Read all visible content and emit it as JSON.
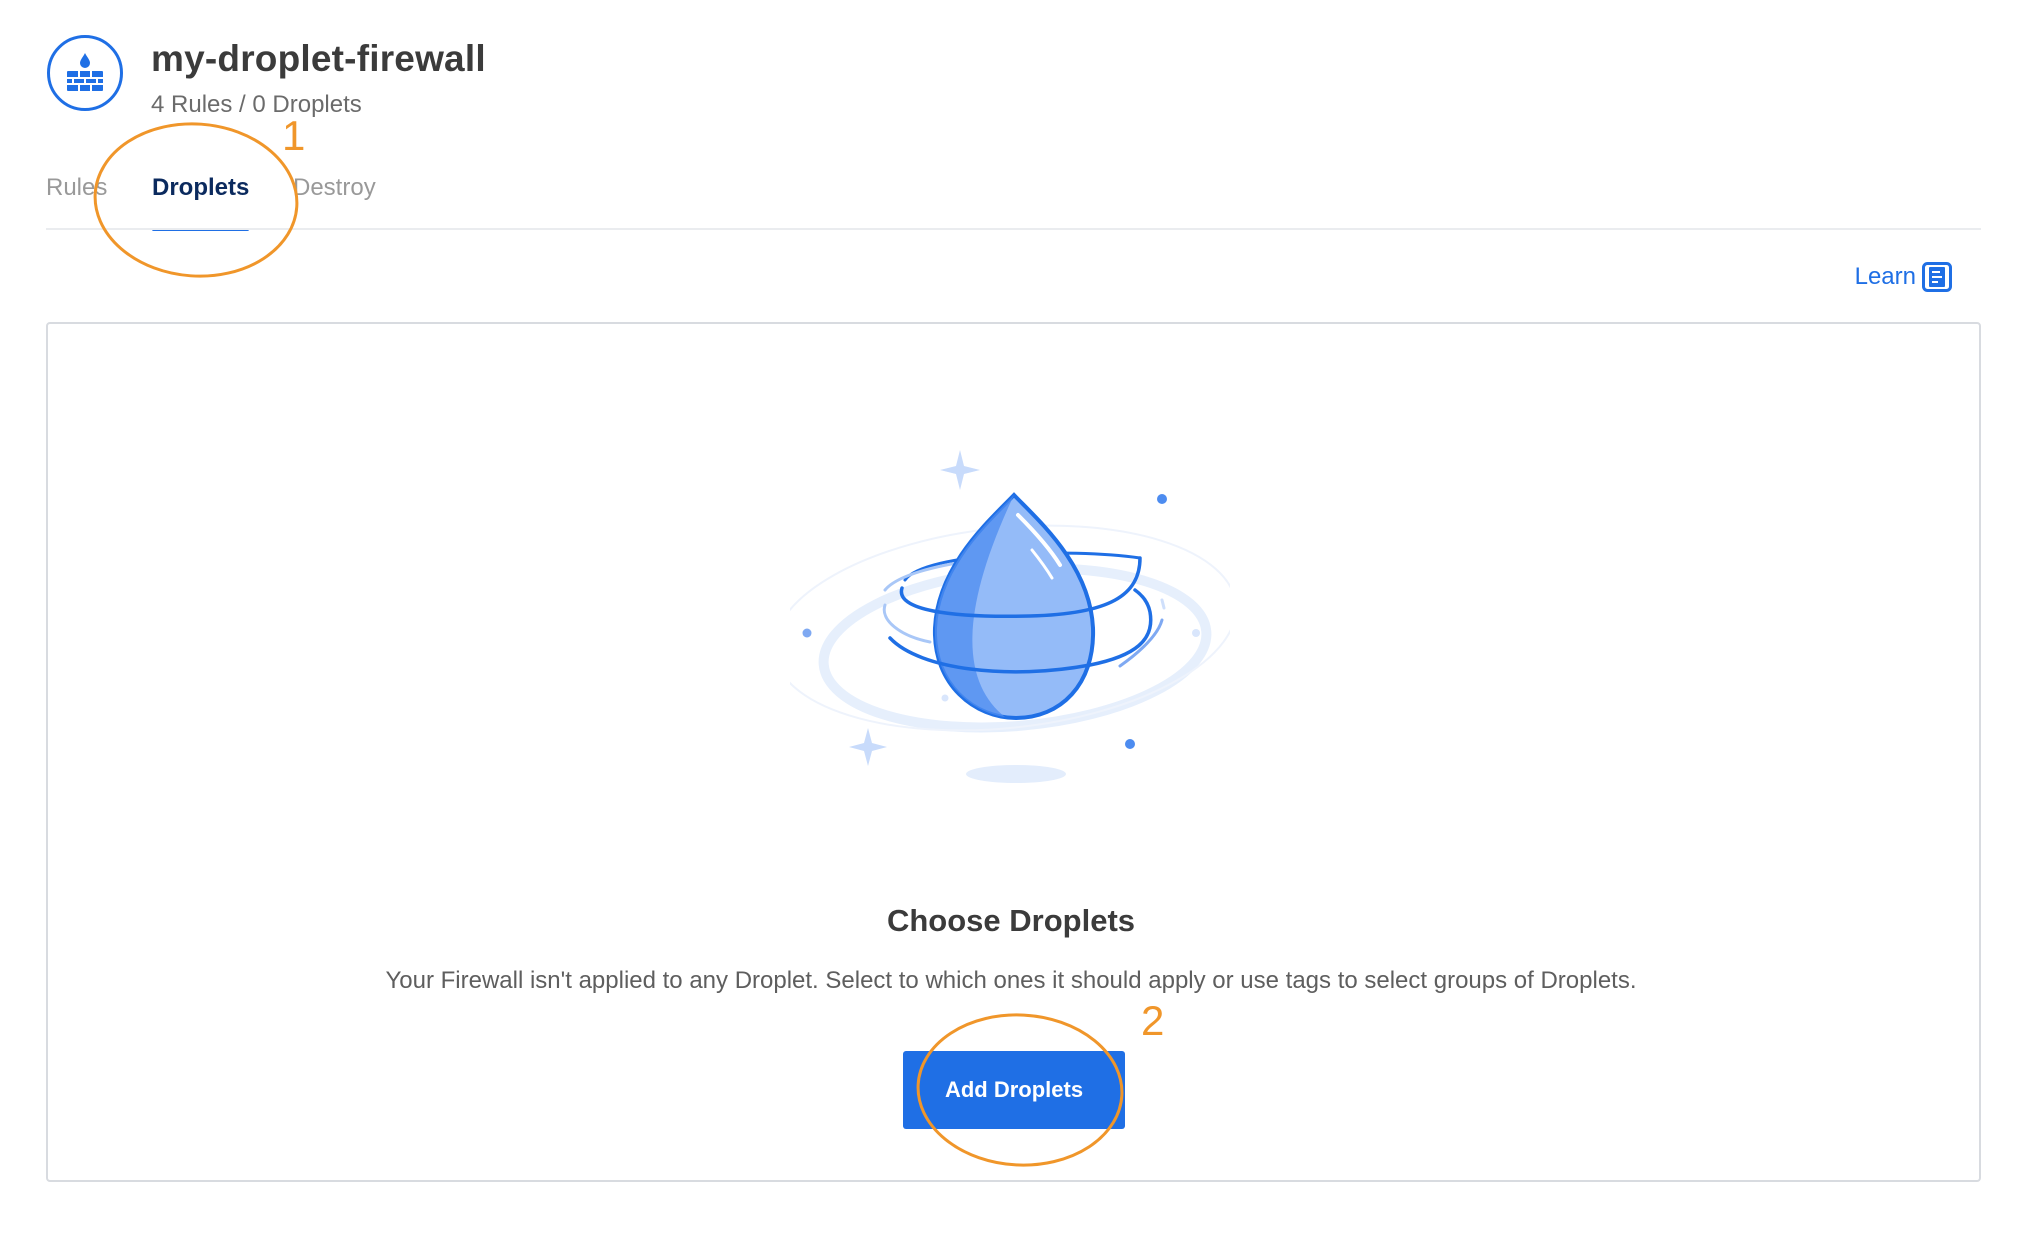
{
  "header": {
    "title": "my-droplet-firewall",
    "subtitle": "4 Rules / 0 Droplets",
    "icon": "firewall-icon"
  },
  "tabs": [
    {
      "label": "Rules",
      "active": false
    },
    {
      "label": "Droplets",
      "active": true
    },
    {
      "label": "Destroy",
      "active": false
    }
  ],
  "learn": {
    "label": "Learn",
    "icon": "document-icon"
  },
  "empty_state": {
    "illustration": "droplet-illustration",
    "title": "Choose Droplets",
    "description": "Your Firewall isn't applied to any Droplet. Select to which ones it should apply or use tags to select groups of Droplets.",
    "button_label": "Add Droplets"
  },
  "annotations": {
    "step1": "1",
    "step2": "2",
    "color": "#f0962a"
  },
  "colors": {
    "accent": "#1f6fe5",
    "active_tab_text": "#0b2a5e",
    "inactive_tab_text": "#999999"
  }
}
